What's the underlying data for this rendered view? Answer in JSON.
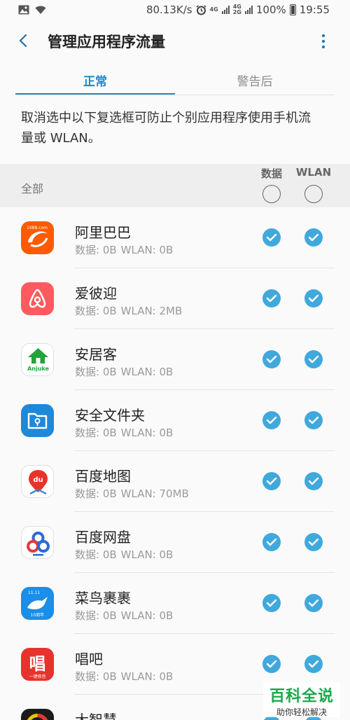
{
  "status_bar": {
    "speed": "80.13K/s",
    "net1": "4G",
    "net2_top": "4G",
    "net2_bottom": "2G",
    "battery": "100%",
    "time": "19:55"
  },
  "app_bar": {
    "title": "管理应用程序流量"
  },
  "tabs": [
    {
      "label": "正常"
    },
    {
      "label": "警告后"
    }
  ],
  "description": "取消选中以下复选框可防止个别应用程序使用手机流量或 WLAN。",
  "header": {
    "all_label": "全部",
    "col_data": "数据",
    "col_wlan": "WLAN"
  },
  "apps": [
    {
      "name": "阿里巴巴",
      "data": "数据: 0B",
      "wlan": "WLAN: 0B"
    },
    {
      "name": "爱彼迎",
      "data": "数据: 0B",
      "wlan": "WLAN: 2MB"
    },
    {
      "name": "安居客",
      "data": "数据: 0B",
      "wlan": "WLAN: 0B"
    },
    {
      "name": "安全文件夹",
      "data": "数据: 0B",
      "wlan": "WLAN: 0B"
    },
    {
      "name": "百度地图",
      "data": "数据: 0B",
      "wlan": "WLAN: 70MB"
    },
    {
      "name": "百度网盘",
      "data": "数据: 0B",
      "wlan": "WLAN: 0B"
    },
    {
      "name": "菜鸟裹裹",
      "data": "数据: 0B",
      "wlan": "WLAN: 0B"
    },
    {
      "name": "唱吧",
      "data": "数据: 0B",
      "wlan": "WLAN: 0B"
    },
    {
      "name": "大智慧",
      "data": "",
      "wlan": ""
    }
  ],
  "icon_labels": {
    "alibaba": "1688.com",
    "anjuke": "Anjuke",
    "baidu_map": "du",
    "cainiao_top": "11.11",
    "cainiao_bottom": "10周年",
    "changba_glyph": "唱",
    "changba_sub": "一键修音"
  },
  "watermark": {
    "top": "百科全说",
    "bottom": "助你轻松解决"
  },
  "colors": {
    "accent": "#1f87c7",
    "check": "#3fa9dc",
    "watermark_green": "#1aa84b"
  }
}
